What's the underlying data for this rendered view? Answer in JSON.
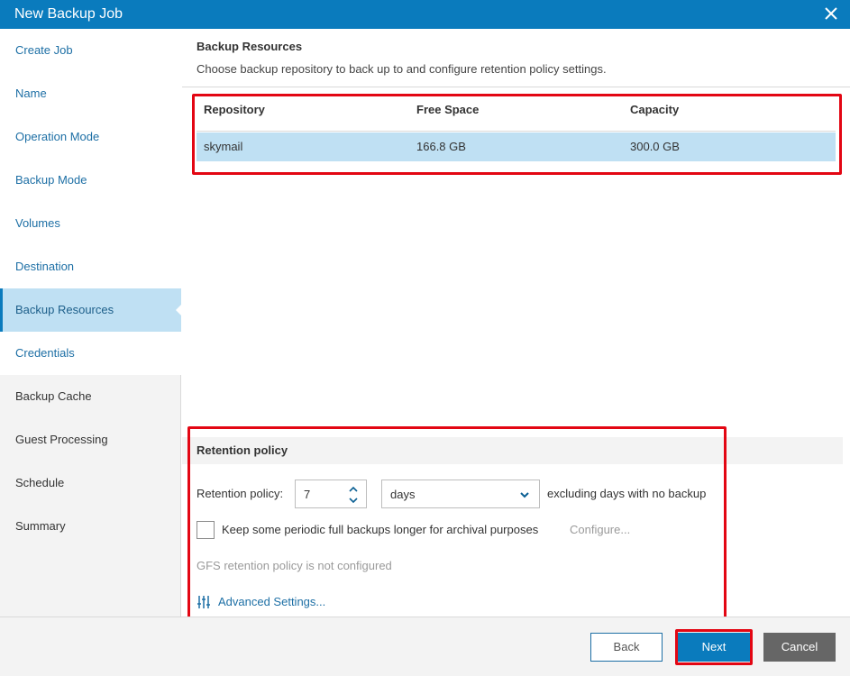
{
  "window": {
    "title": "New Backup Job"
  },
  "sidebar": {
    "items": [
      {
        "label": "Create Job",
        "state": "visited"
      },
      {
        "label": "Name",
        "state": "visited"
      },
      {
        "label": "Operation Mode",
        "state": "visited"
      },
      {
        "label": "Backup Mode",
        "state": "visited"
      },
      {
        "label": "Volumes",
        "state": "visited"
      },
      {
        "label": "Destination",
        "state": "visited"
      },
      {
        "label": "Backup Resources",
        "state": "active"
      },
      {
        "label": "Credentials",
        "state": "visited"
      },
      {
        "label": "Backup Cache",
        "state": "pending"
      },
      {
        "label": "Guest Processing",
        "state": "pending"
      },
      {
        "label": "Schedule",
        "state": "pending"
      },
      {
        "label": "Summary",
        "state": "pending"
      }
    ]
  },
  "page": {
    "heading": "Backup Resources",
    "subheading": "Choose backup repository to back up to and configure retention policy settings."
  },
  "repo_table": {
    "columns": [
      "Repository",
      "Free Space",
      "Capacity"
    ],
    "rows": [
      {
        "repository": "skymail",
        "free_space": "166.8 GB",
        "capacity": "300.0 GB"
      }
    ]
  },
  "retention": {
    "section_title": "Retention policy",
    "label": "Retention policy:",
    "value": "7",
    "unit": "days",
    "suffix": "excluding days with no backup",
    "gfs_checkbox_label": "Keep some periodic full backups longer for archival purposes",
    "gfs_checked": false,
    "configure_link": "Configure...",
    "gfs_status": "GFS retention policy is not configured",
    "advanced_link": "Advanced Settings..."
  },
  "footer": {
    "back_label": "Back",
    "next_label": "Next",
    "cancel_label": "Cancel"
  },
  "colors": {
    "accent": "#0a7bbd",
    "highlight": "#e30613",
    "selection": "#bfe0f3",
    "link": "#1d6fa5"
  }
}
